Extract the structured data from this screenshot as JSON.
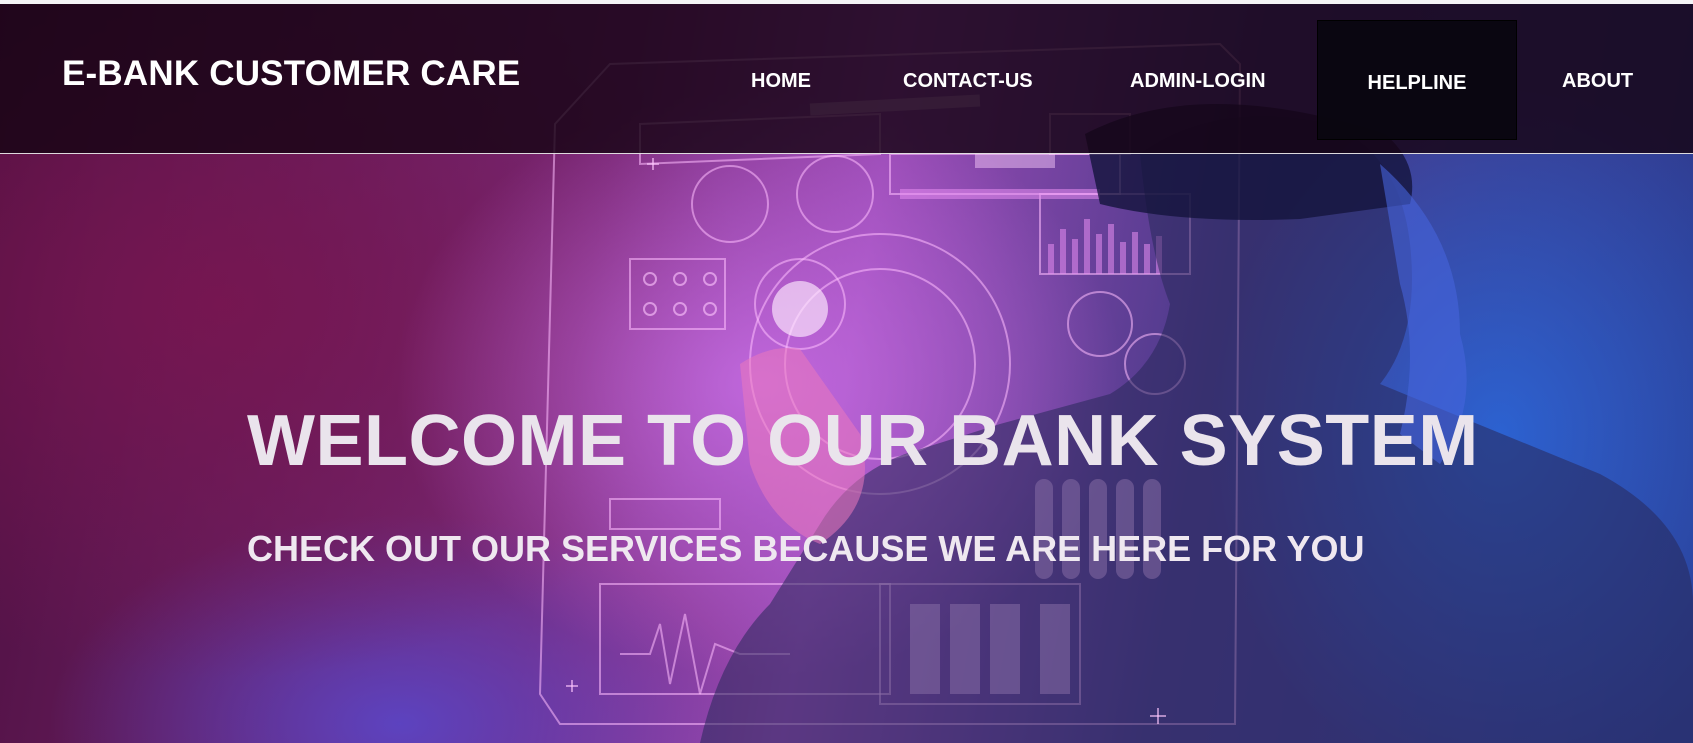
{
  "brand": {
    "title": "E-BANK CUSTOMER CARE"
  },
  "nav": {
    "items": [
      {
        "label": "HOME"
      },
      {
        "label": "CONTACT-US"
      },
      {
        "label": "ADMIN-LOGIN"
      },
      {
        "label": "HELPLINE"
      },
      {
        "label": "ABOUT"
      }
    ],
    "active_item": "HELPLINE"
  },
  "hero": {
    "title": "WELCOME TO OUR BANK SYSTEM",
    "subtitle": "CHECK OUT OUR SERVICES BECAUSE WE ARE HERE FOR YOU",
    "image": "man-wearing-vr-headset-futuristic-hud-background"
  },
  "colors": {
    "navbar_bg": "#160414",
    "active_nav_bg": "#0a0610",
    "hero_magenta": "#7a2a7a",
    "hero_blue": "#2a3f96",
    "text_white": "#ffffff"
  }
}
